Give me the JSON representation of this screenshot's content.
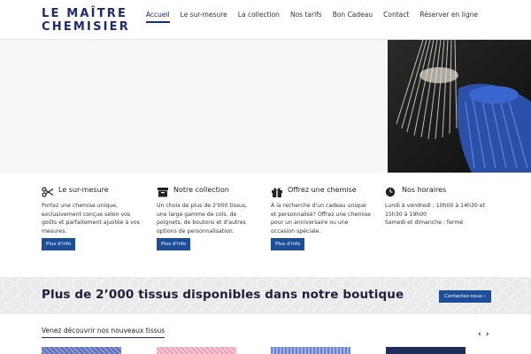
{
  "header": {
    "logo_line1": "LE MAÎTRE",
    "logo_line2": "CHEMISIER",
    "nav": [
      {
        "label": "Accueil",
        "active": true
      },
      {
        "label": "Le sur-mesure"
      },
      {
        "label": "La collection"
      },
      {
        "label": "Nos tarifs"
      },
      {
        "label": "Bon Cadeau"
      },
      {
        "label": "Contact"
      },
      {
        "label": "Réserver en ligne"
      }
    ]
  },
  "features": [
    {
      "icon": "scissors-icon",
      "title": "Le sur-mesure",
      "text": "Portez une chemise unique, exclusivement conçue selon vos goûts et parfaitement ajustée à vos mesures.",
      "button": "Plus d'info"
    },
    {
      "icon": "box-icon",
      "title": "Notre collection",
      "text": "Un choix de plus de 2'000 tissus, une large gamme de cols, de poignets, de boutons et d'autres options de personnalisation.",
      "button": "Plus d'info"
    },
    {
      "icon": "gift-icon",
      "title": "Offrez une chemise",
      "text": "À la recherche d'un cadeau unique et personnalisé? Offrez une chemise pour un anniversaire ou une occasion spéciale.",
      "button": "Plus d'info"
    },
    {
      "icon": "clock-icon",
      "title": "Nos horaires",
      "text_line1": "Lundi à vendredi : 10h00 à 14h30 et 15h30 à 19h00",
      "text_line2": "Samedi et dimanche : fermé"
    }
  ],
  "banner": {
    "title": "Plus de 2’000 tissus disponibles dans notre boutique",
    "button": "Contactez-nous  ›"
  },
  "new_fabrics": {
    "title": "Venez découvrir nos nouveaux tissus",
    "prev": "‹",
    "next": "›"
  },
  "colors": {
    "brand": "#1d2a6b",
    "button": "#1d4e9a"
  }
}
